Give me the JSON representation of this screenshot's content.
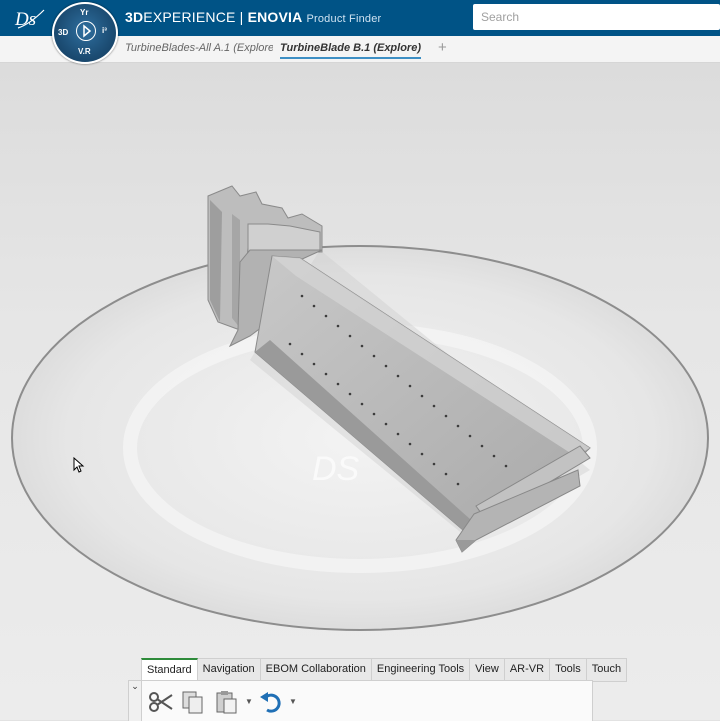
{
  "header": {
    "brand_bold": "3D",
    "brand_light": "EXPERIENCE",
    "brand_sep": " | ",
    "brand_product": "ENOVIA",
    "app_name": "Product Finder",
    "search_placeholder": "Search",
    "compass": {
      "top": "Yr",
      "left": "3D",
      "right": "i³",
      "bottom": "V.R"
    }
  },
  "tabs": [
    {
      "label": "TurbineBlades-All A.1 (Explore)",
      "active": false
    },
    {
      "label": "TurbineBlade B.1 (Explore)",
      "active": true
    }
  ],
  "tab_add": "+",
  "viewport": {
    "model": "turbine blade",
    "watermark": "DS"
  },
  "action_bar": {
    "tabs": [
      "Standard",
      "Navigation",
      "EBOM Collaboration",
      "Engineering Tools",
      "View",
      "AR-VR",
      "Tools",
      "Touch"
    ],
    "active_tab": "Standard",
    "tools": [
      "cut-icon",
      "copy-icon",
      "paste-icon",
      "undo-icon"
    ]
  },
  "colors": {
    "header": "#005386",
    "active_tab_underline": "#3d8fc4",
    "action_tab_accent": "#2e8b3a"
  }
}
